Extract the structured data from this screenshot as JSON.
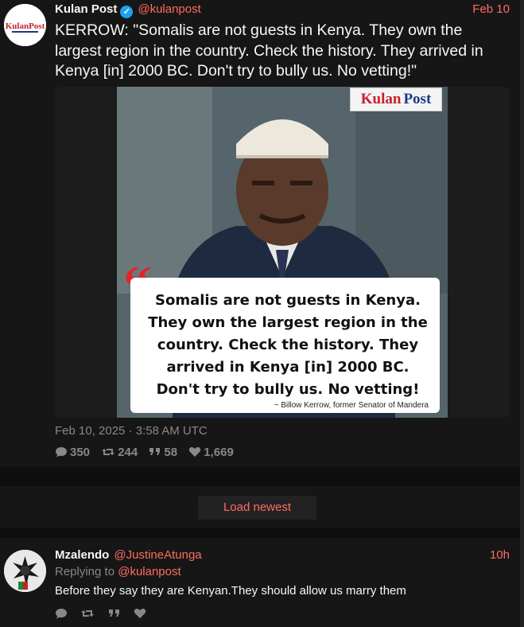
{
  "main_tweet": {
    "fullname": "Kulan Post",
    "username": "@kulanpost",
    "date_short": "Feb 10",
    "text": "KERROW: \"Somalis are not guests in Kenya. They own the largest region in the country. Check the history. They arrived in Kenya [in] 2000 BC. Don't try to bully us. No vetting!\"",
    "avatar_text": "KulanPost",
    "image": {
      "logo_text_1": "Kulan",
      "logo_text_2": "Post",
      "quote_lines": [
        "Somalis are not guests in Kenya.",
        "They own the largest region in the",
        "country. Check the history. They",
        "arrived in Kenya [in] 2000 BC.",
        "Don't try to bully us. No vetting!"
      ],
      "attribution": "~ Billow Kerrow, former Senator of Mandera"
    },
    "published": "Feb 10, 2025 · 3:58 AM UTC",
    "stats": {
      "replies": "350",
      "retweets": "244",
      "quotes": "58",
      "likes": "1,669"
    }
  },
  "load_newest": "Load newest",
  "reply_tweet": {
    "fullname": "Mzalendo",
    "username": "@JustineAtunga",
    "date_short": "10h",
    "replying_prefix": "Replying to",
    "replying_to": "@kulanpost",
    "text": "Before they say they are Kenyan.They should allow us marry them"
  },
  "colors": {
    "accent": "#ff6c60",
    "background": "#0f0f0f",
    "panel": "#161616",
    "muted": "#888889",
    "verified": "#1da1f2"
  }
}
